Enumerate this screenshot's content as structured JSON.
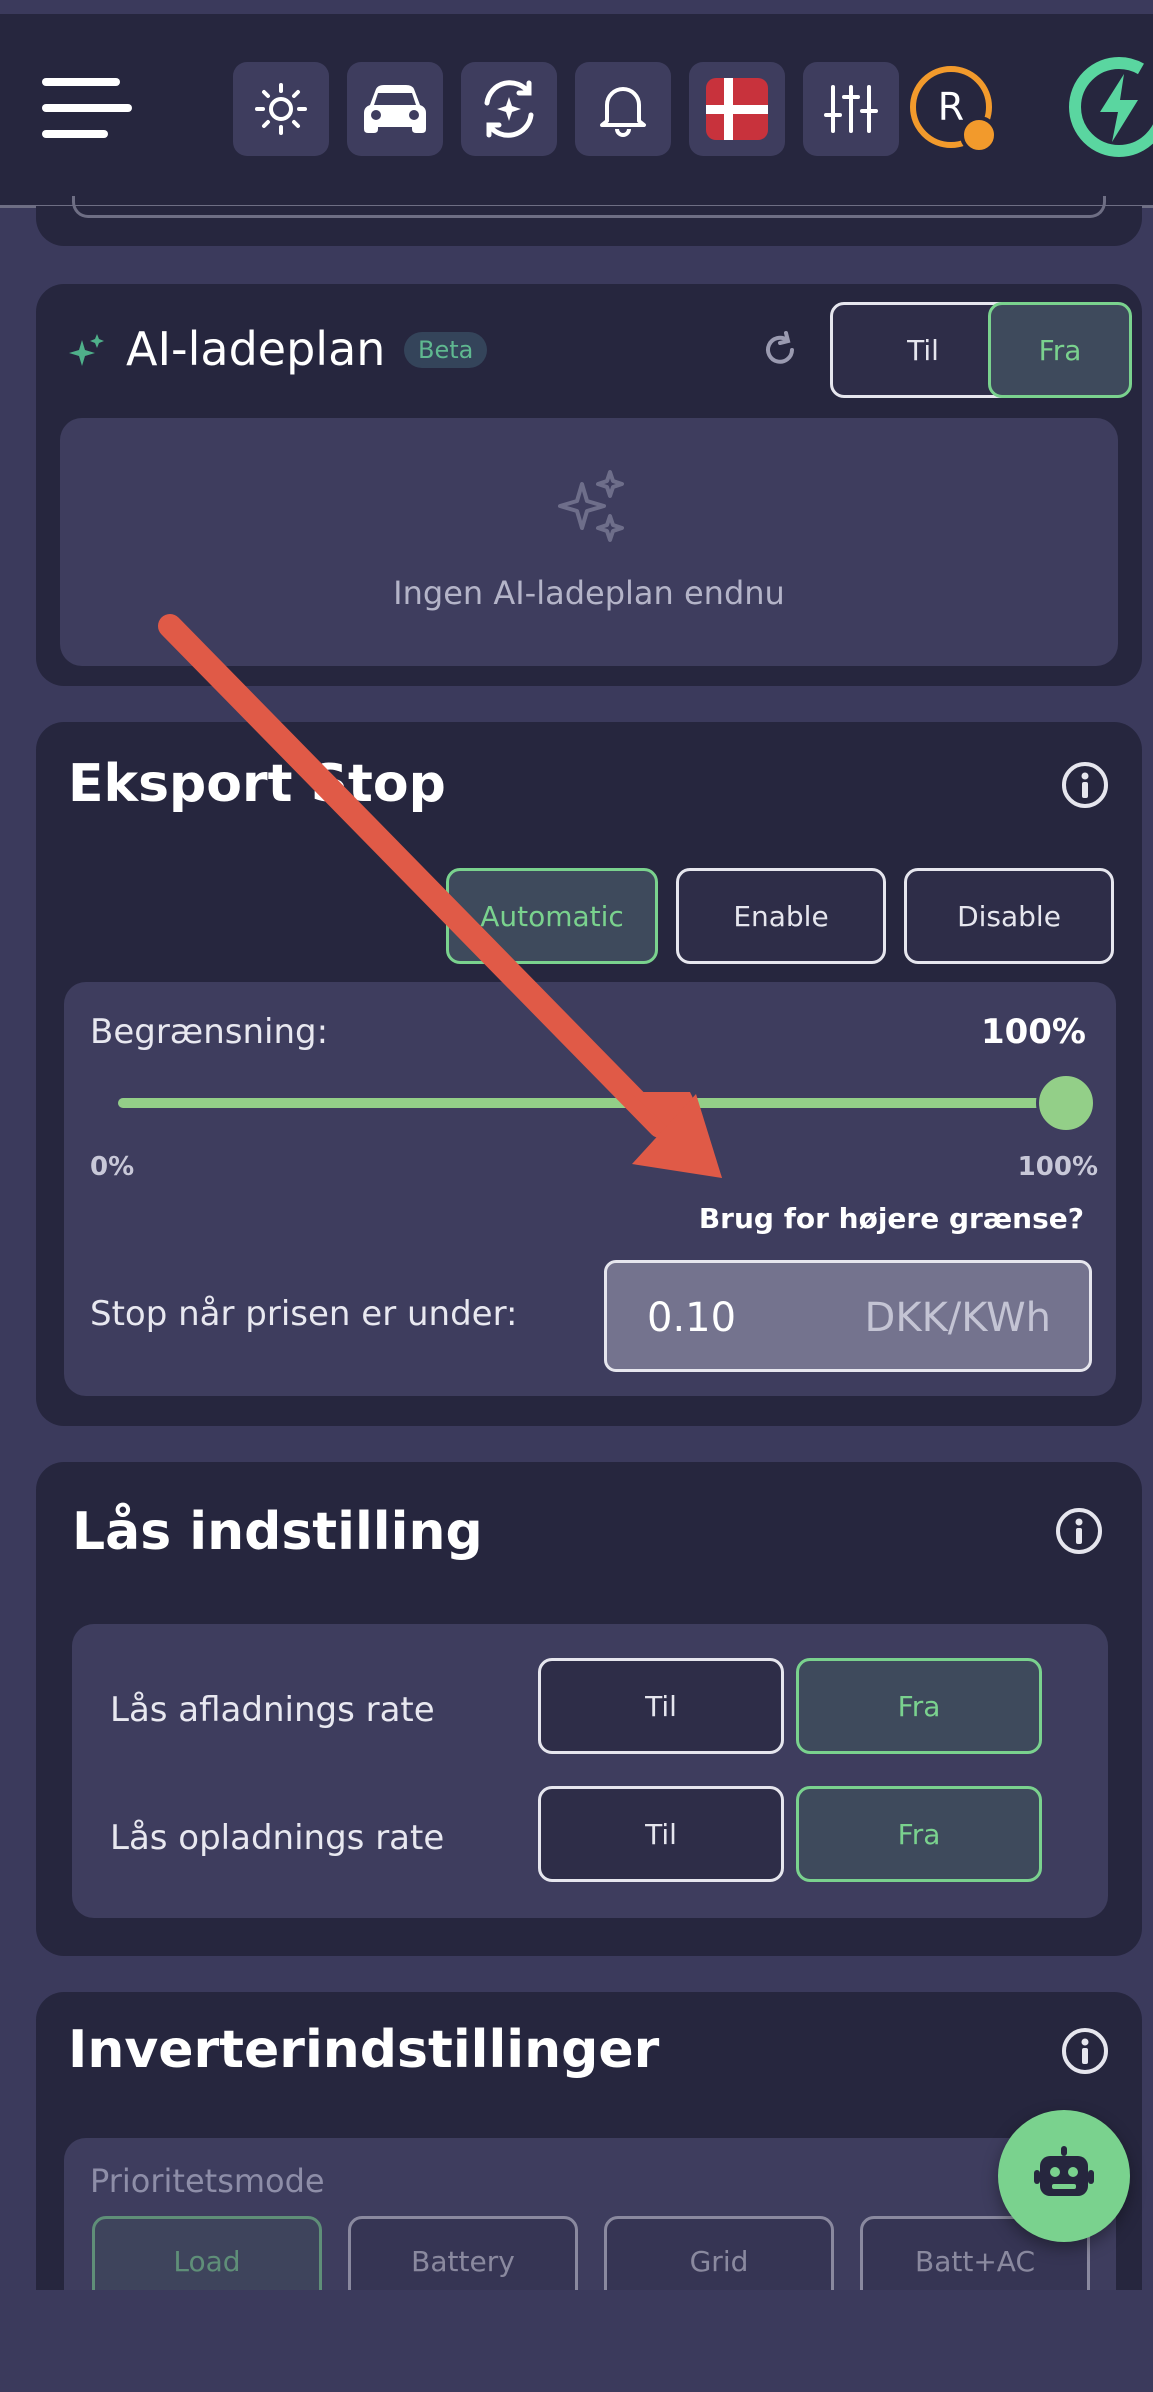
{
  "header": {
    "avatar_letter": "R",
    "icons": [
      "sun-icon",
      "car-icon",
      "sync-sparkle-icon",
      "bell-icon",
      "denmark-flag-icon",
      "sliders-icon",
      "charging-logo-icon"
    ]
  },
  "ai_plan": {
    "title": "AI-ladeplan",
    "badge": "Beta",
    "on_label": "Til",
    "off_label": "Fra",
    "empty_text": "Ingen AI-ladeplan endnu"
  },
  "export_stop": {
    "title": "Eksport Stop",
    "modes": [
      "Automatic",
      "Enable",
      "Disable"
    ],
    "active_mode": "Automatic",
    "limit_label": "Begrænsning:",
    "limit_value": "100%",
    "limit_fraction": 1.0,
    "min_label": "0%",
    "max_label": "100%",
    "higher_limit_link": "Brug for højere grænse?",
    "price_label": "Stop når prisen er under:",
    "price_value": "0.10",
    "price_unit": "DKK/KWh"
  },
  "lock_settings": {
    "title": "Lås indstilling",
    "rows": [
      {
        "label": "Lås afladnings rate",
        "on": "Til",
        "off": "Fra"
      },
      {
        "label": "Lås opladnings rate",
        "on": "Til",
        "off": "Fra"
      }
    ]
  },
  "inverter": {
    "title": "Inverterindstillinger",
    "priority_label": "Prioritetsmode",
    "modes": [
      "Load",
      "Battery",
      "Grid",
      "Batt+AC"
    ],
    "active_mode": "Load"
  },
  "colors": {
    "accent_green": "#7ad28e",
    "annotation_arrow": "#e05a47",
    "card_bg": "#26263e",
    "page_bg": "#3b3a5c"
  }
}
